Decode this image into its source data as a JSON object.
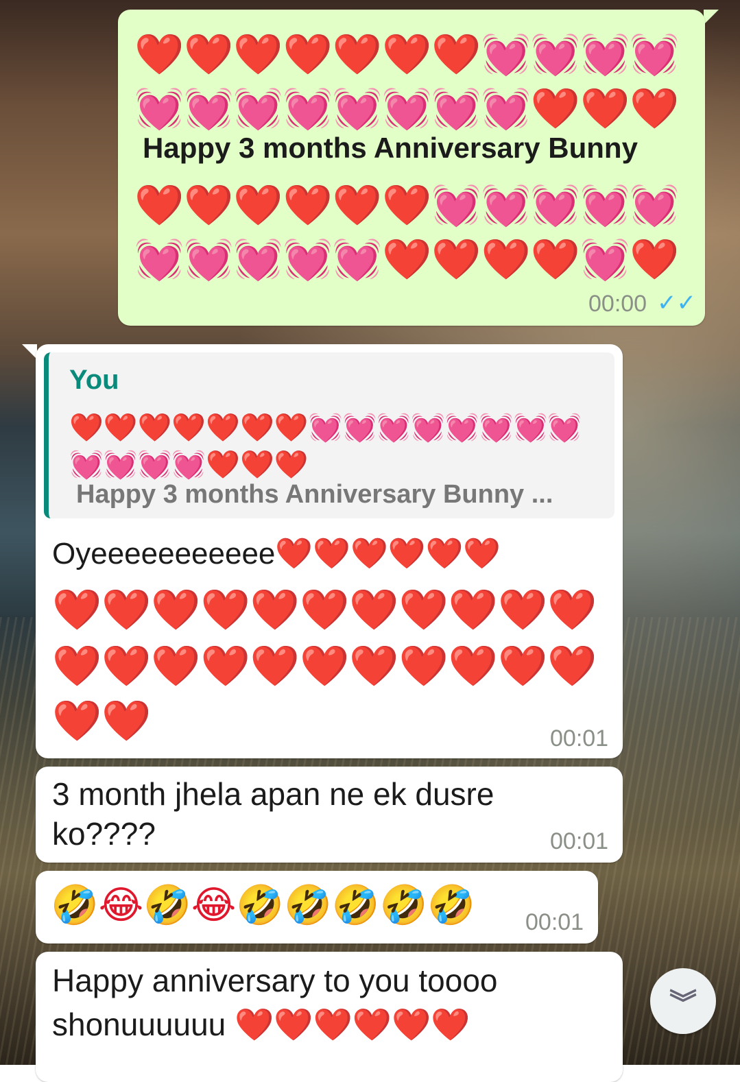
{
  "background": {
    "description": "coastal-scene-wallpaper"
  },
  "messages": [
    {
      "direction": "outgoing",
      "emoji_row_1": "❤️❤️❤️❤️❤️❤️❤️💓💓💓💓",
      "emoji_row_2": "💓💓💓💓💓💓💓💓❤️❤️❤️",
      "text": "Happy 3 months Anniversary Bunny",
      "emoji_row_3": "❤️❤️❤️❤️❤️❤️💓💓💓💓💓",
      "emoji_row_4": "💓💓💓💓💓❤️❤️❤️❤️💓❤️",
      "time": "00:00",
      "status_icon": "double-check-read",
      "status_glyph": "✓✓"
    },
    {
      "direction": "incoming",
      "quote": {
        "author": "You",
        "emoji_row_1": "❤️❤️❤️❤️❤️❤️❤️💓💓💓💓💓💓💓💓",
        "emoji_row_2": "💓💓💓💓❤️❤️❤️",
        "text": "Happy 3 months Anniversary Bunny ..."
      },
      "text_line_1": "Oyeeeeeeeeeee❤️❤️❤️❤️❤️❤️",
      "emoji_row_2": "❤️❤️❤️❤️❤️❤️❤️❤️❤️❤️❤️",
      "emoji_row_3": "❤️❤️❤️❤️❤️❤️❤️❤️❤️❤️❤️",
      "emoji_row_4": "❤️❤️",
      "time": "00:01"
    },
    {
      "direction": "incoming",
      "text_line_1": "3 month jhela apan ne ek dusre",
      "text_line_2": "ko????",
      "time": "00:01"
    },
    {
      "direction": "incoming",
      "emoji_row": "🤣😂🤣😂🤣🤣🤣🤣🤣",
      "time": "00:01"
    },
    {
      "direction": "incoming",
      "text_line_1": "Happy anniversary to you toooo",
      "text_line_2": "shonuuuuuu ❤️❤️❤️❤️❤️❤️"
    }
  ],
  "scroll_button": {
    "icon": "double-chevron-down-icon",
    "glyph": "︾"
  },
  "colors": {
    "outgoing_bubble": "#e1ffc7",
    "incoming_bubble": "#ffffff",
    "quote_accent": "#0a8a7a",
    "read_ticks": "#3fb3ef"
  }
}
